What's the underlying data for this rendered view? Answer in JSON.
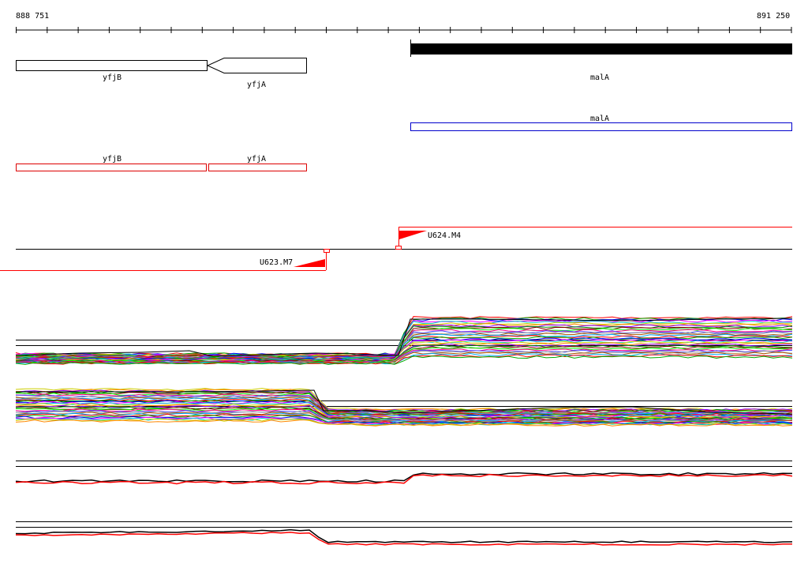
{
  "ruler": {
    "start_label": "888 751",
    "end_label": "891 250"
  },
  "genes_top": [
    {
      "label": "yfjB"
    },
    {
      "label": "yfjA"
    },
    {
      "label": "malA"
    }
  ],
  "genes_blue": [
    {
      "label": "malA",
      "color": "#0000cc"
    }
  ],
  "genes_red": [
    {
      "label": "yfjB",
      "color": "#dd0000"
    },
    {
      "label": "yfjA",
      "color": "#dd0000"
    }
  ],
  "markers": [
    {
      "label": "U624.M4",
      "color": "#ff0000"
    },
    {
      "label": "U623.M7",
      "color": "#ff0000"
    }
  ],
  "colors": {
    "axis": "#000000",
    "marker": "#ff0000",
    "pair_line": "#ff0000",
    "multi_palette": [
      "#ff0000",
      "#00aa00",
      "#0000ff",
      "#ff00ff",
      "#00cccc",
      "#cccc00",
      "#ff8800",
      "#8800ff",
      "#008800",
      "#880000",
      "#00ff00",
      "#ff0088",
      "#4444ff",
      "#999999",
      "#aa5500",
      "#00aaff"
    ]
  }
}
